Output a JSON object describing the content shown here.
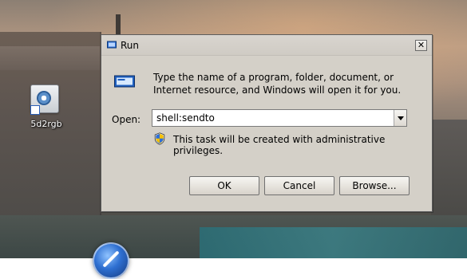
{
  "desktop": {
    "icon_label": "5d2rgb"
  },
  "dialog": {
    "title": "Run",
    "close_glyph": "✕",
    "prompt": "Type the name of a program, folder, document, or Internet resource, and Windows will open it for you.",
    "open_label": "Open:",
    "open_value": "shell:sendto",
    "admin_note": "This task will be created with administrative privileges.",
    "buttons": {
      "ok": "OK",
      "cancel": "Cancel",
      "browse": "Browse..."
    }
  },
  "colors": {
    "dialog_bg": "#d4d0c8",
    "title_bg": "#cfcbc4",
    "accent_blue": "#2e6fd1"
  },
  "icons": {
    "title": "run-icon",
    "prompt": "run-program-icon",
    "shield": "uac-shield-icon",
    "desktop_shortcut": "shortcut-arrow-icon",
    "start": "windows-start-orb-icon"
  }
}
